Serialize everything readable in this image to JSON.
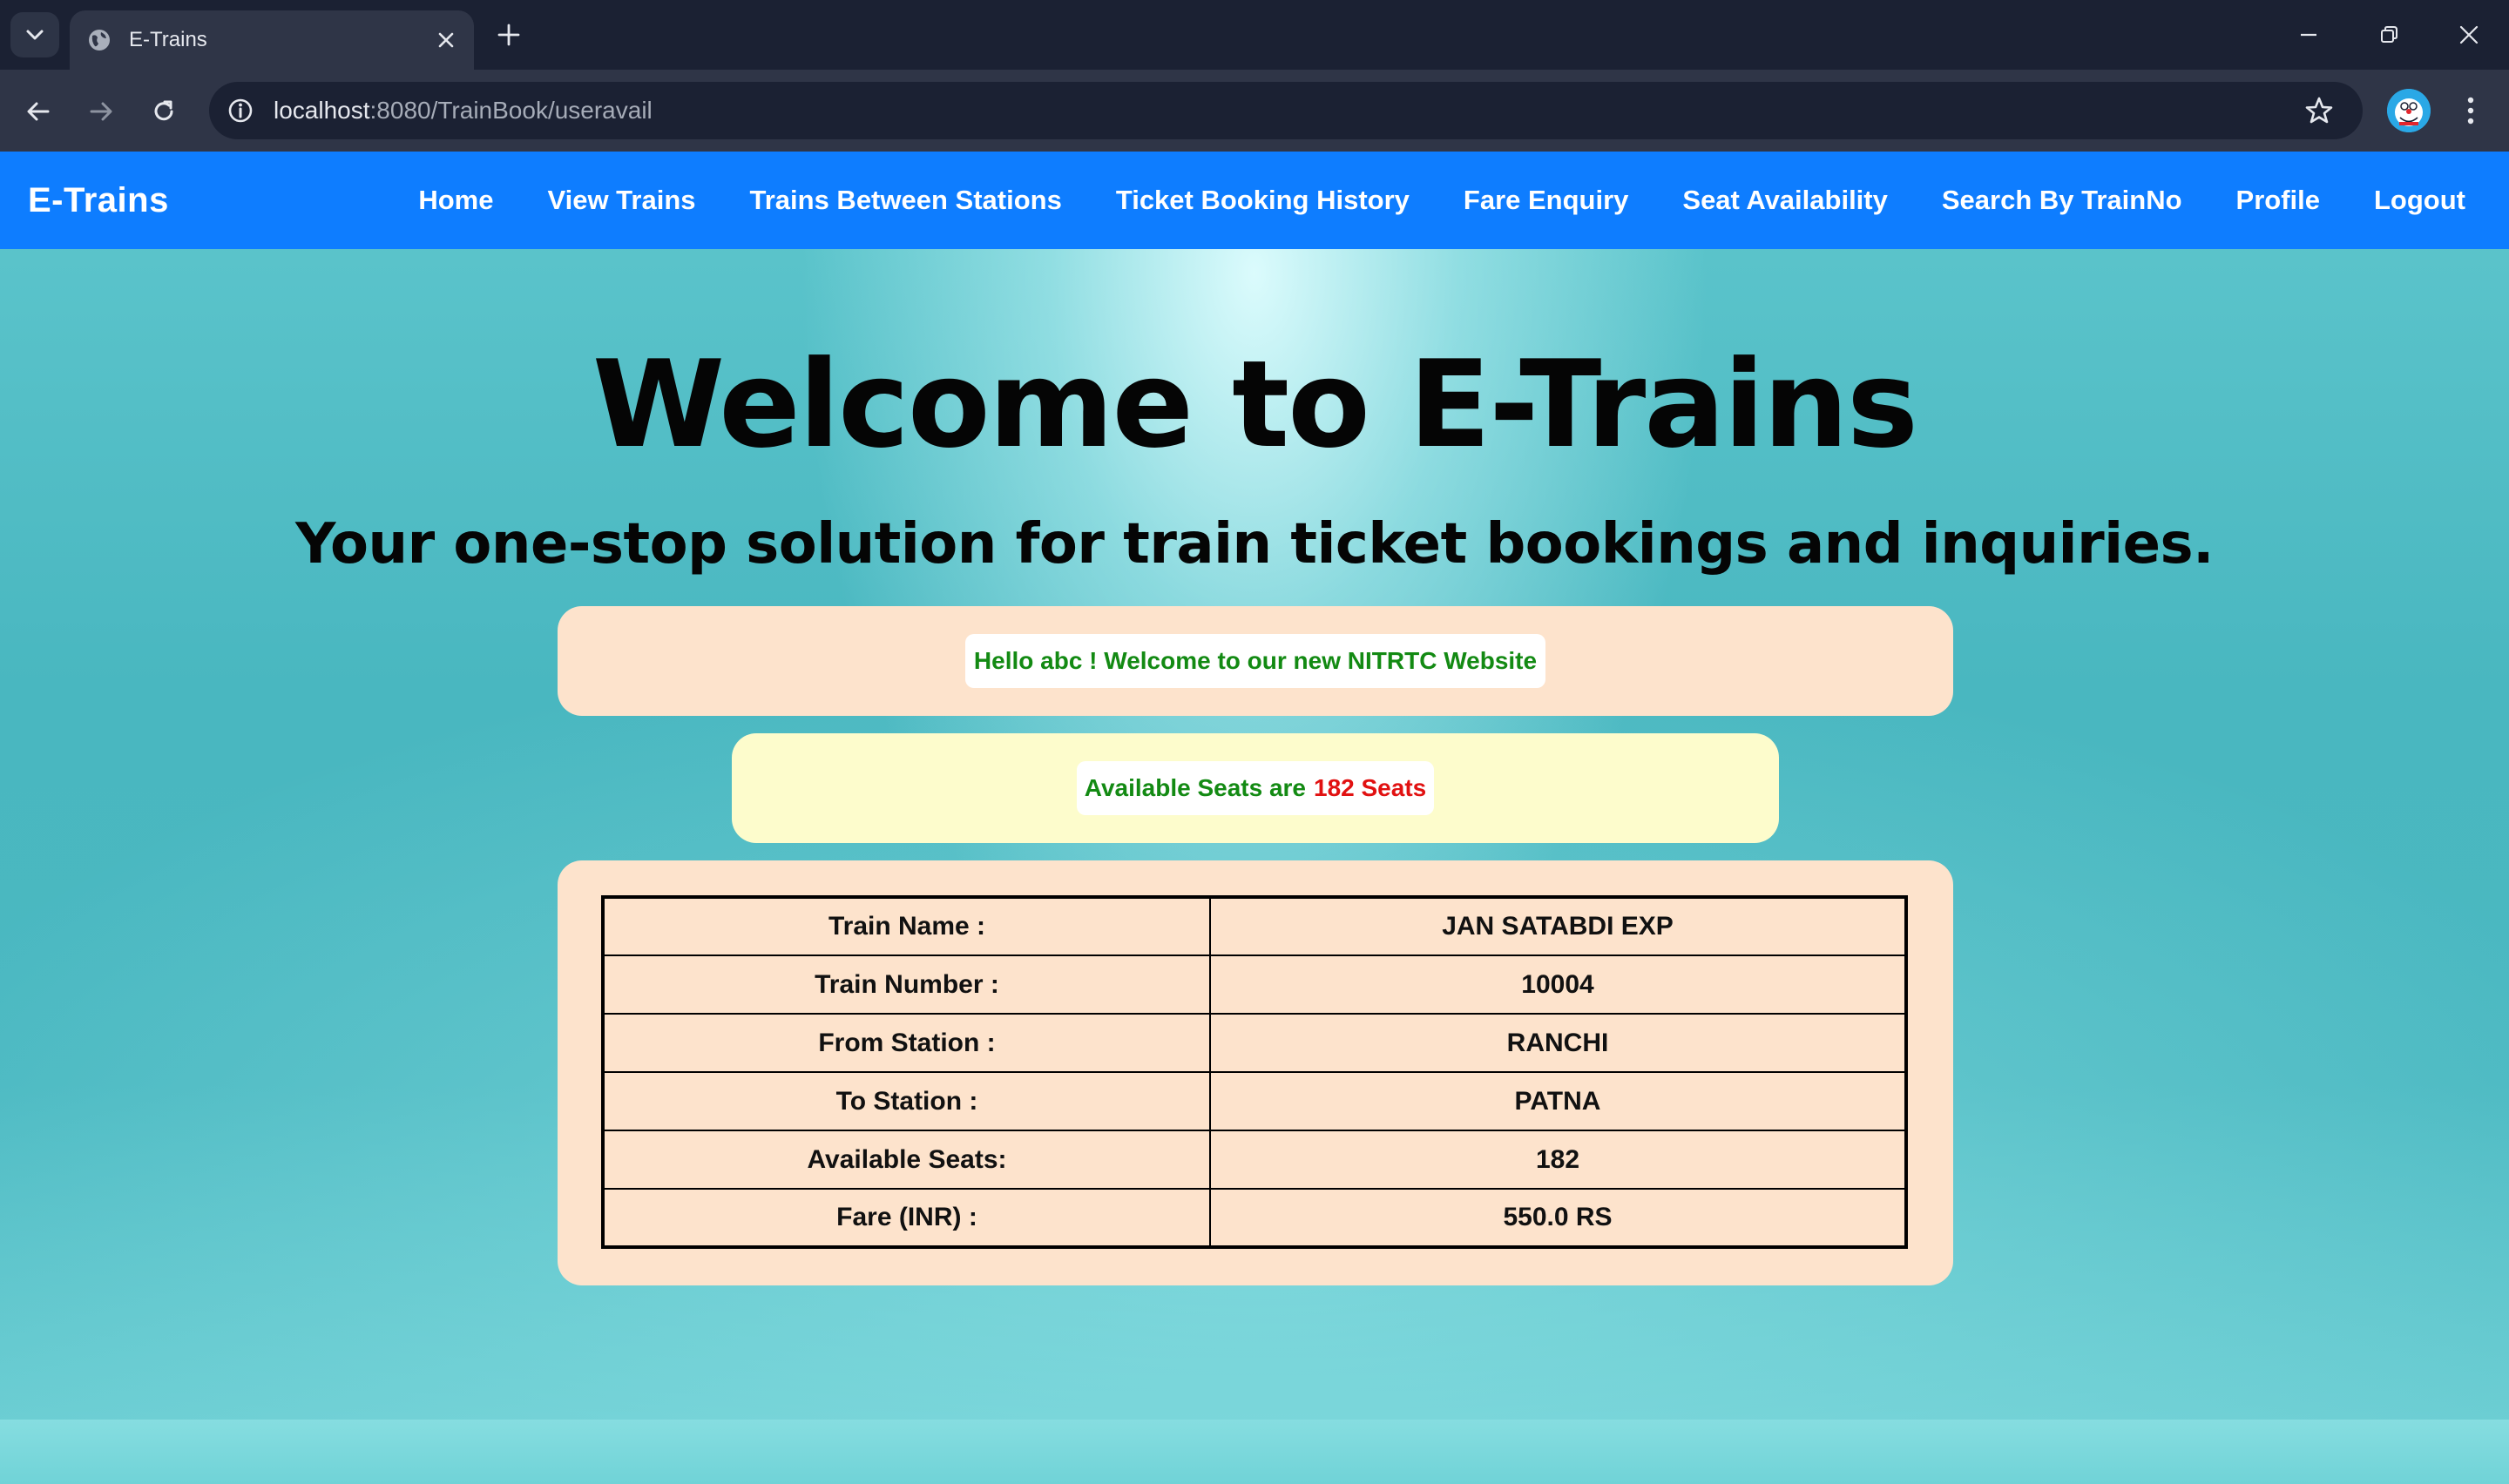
{
  "browser": {
    "tab_title": "E-Trains",
    "url_host": "localhost",
    "url_rest": ":8080/TrainBook/useravail",
    "icons": [
      "tab-search-icon",
      "globe-icon",
      "close-icon",
      "plus-icon",
      "minimize-icon",
      "restore-icon",
      "window-close-icon",
      "back-arrow-icon",
      "forward-arrow-icon",
      "reload-icon",
      "site-info-icon",
      "star-icon",
      "profile-avatar",
      "kebab-menu-icon"
    ]
  },
  "navbar": {
    "brand": "E-Trains",
    "links": [
      "Home",
      "View Trains",
      "Trains Between Stations",
      "Ticket Booking History",
      "Fare Enquiry",
      "Seat Availability",
      "Search By TrainNo",
      "Profile",
      "Logout"
    ],
    "color": "#0e7dff"
  },
  "hero": {
    "title": "Welcome to E-Trains",
    "subtitle": "Your one-stop solution for train ticket bookings and inquiries."
  },
  "messages": {
    "welcome": "Hello abc ! Welcome to our new NITRTC Website",
    "seats_prefix": "Available Seats are",
    "seats_value": "182 Seats"
  },
  "train_info": [
    {
      "label": "Train Name :",
      "value": "JAN SATABDI EXP"
    },
    {
      "label": "Train Number :",
      "value": "10004"
    },
    {
      "label": "From Station :",
      "value": "RANCHI"
    },
    {
      "label": "To Station :",
      "value": "PATNA"
    },
    {
      "label": "Available Seats:",
      "value": "182"
    },
    {
      "label": "Fare (INR) :",
      "value": "550.0 RS"
    }
  ],
  "colors": {
    "success_text": "#138a13",
    "alert_text": "#e11111",
    "card_peach": "#fde3cc",
    "card_yellow": "#fdfccc"
  }
}
